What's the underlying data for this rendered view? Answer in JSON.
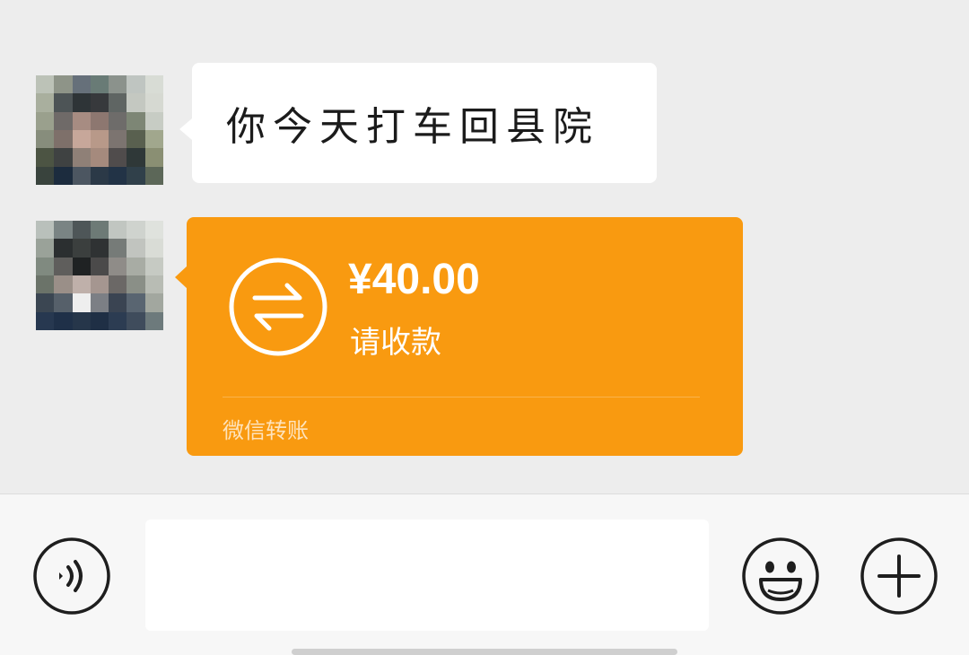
{
  "messages": [
    {
      "type": "text",
      "text": "你今天打车回县院"
    },
    {
      "type": "transfer",
      "amount": "¥40.00",
      "status": "请收款",
      "footer": "微信转账"
    }
  ],
  "input": {
    "placeholder": ""
  },
  "colors": {
    "background": "#ededed",
    "transfer_card": "#f99a10",
    "bottom_bar": "#f7f7f7"
  },
  "icons": {
    "transfer": "transfer-arrows-icon",
    "voice": "voice-icon",
    "emoji": "emoji-icon",
    "plus": "plus-icon"
  }
}
